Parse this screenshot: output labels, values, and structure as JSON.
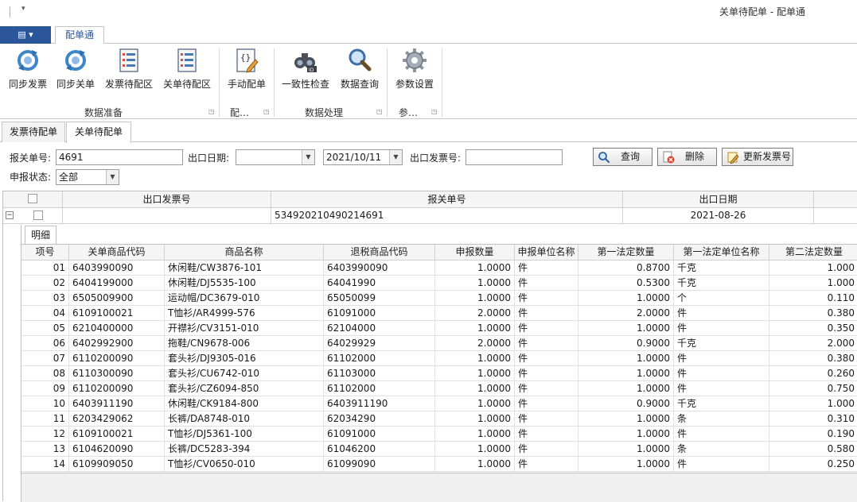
{
  "window": {
    "title": "关单待配单 - 配单通"
  },
  "app_menu": {
    "label": "▤ ▾"
  },
  "ribbon": {
    "tab": "配单通",
    "buttons": [
      {
        "label": "同步发票",
        "icon": "sync-icon"
      },
      {
        "label": "同步关单",
        "icon": "sync-icon"
      },
      {
        "label": "发票待配区",
        "icon": "list-icon"
      },
      {
        "label": "关单待配区",
        "icon": "list-icon"
      },
      {
        "label": "手动配单",
        "icon": "edit-code-icon"
      },
      {
        "label": "一致性检查",
        "icon": "binoculars-icon"
      },
      {
        "label": "数据查询",
        "icon": "magnifier-icon"
      },
      {
        "label": "参数设置",
        "icon": "gear-icon"
      }
    ],
    "groups": [
      "数据准备",
      "配…",
      "数据处理",
      "参…"
    ]
  },
  "doc_tabs": [
    "发票待配单",
    "关单待配单"
  ],
  "filter": {
    "customs_no_label": "报关单号:",
    "customs_no_value": "4691",
    "export_date_label": "出口日期:",
    "export_date_from": "",
    "export_date_to": "2021/10/11",
    "export_invoice_label": "出口发票号:",
    "export_invoice_value": "",
    "status_label": "申报状态:",
    "status_value": "全部",
    "query_button": "查询",
    "delete_button": "删除",
    "update_invoice_button": "更新发票号"
  },
  "master": {
    "columns": [
      "出口发票号",
      "报关单号",
      "出口日期"
    ],
    "row": {
      "invoice_no": "",
      "customs_no": "534920210490214691",
      "export_date": "2021-08-26"
    }
  },
  "detail": {
    "tab": "明细",
    "columns": [
      "项号",
      "关单商品代码",
      "商品名称",
      "退税商品代码",
      "申报数量",
      "申报单位名称",
      "第一法定数量",
      "第一法定单位名称",
      "第二法定数量"
    ],
    "rows": [
      [
        "01",
        "6403990090",
        "休闲鞋/CW3876-101",
        "6403990090",
        "1.0000",
        "件",
        "0.8700",
        "千克",
        "1.000"
      ],
      [
        "02",
        "6404199000",
        "休闲鞋/DJ5535-100",
        "64041990",
        "1.0000",
        "件",
        "0.5300",
        "千克",
        "1.000"
      ],
      [
        "03",
        "6505009900",
        "运动帽/DC3679-010",
        "65050099",
        "1.0000",
        "件",
        "1.0000",
        "个",
        "0.110"
      ],
      [
        "04",
        "6109100021",
        "T恤衫/AR4999-576",
        "61091000",
        "2.0000",
        "件",
        "2.0000",
        "件",
        "0.380"
      ],
      [
        "05",
        "6210400000",
        "开襟衫/CV3151-010",
        "62104000",
        "1.0000",
        "件",
        "1.0000",
        "件",
        "0.350"
      ],
      [
        "06",
        "6402992900",
        "拖鞋/CN9678-006",
        "64029929",
        "2.0000",
        "件",
        "0.9000",
        "千克",
        "2.000"
      ],
      [
        "07",
        "6110200090",
        "套头衫/DJ9305-016",
        "61102000",
        "1.0000",
        "件",
        "1.0000",
        "件",
        "0.380"
      ],
      [
        "08",
        "6110300090",
        "套头衫/CU6742-010",
        "61103000",
        "1.0000",
        "件",
        "1.0000",
        "件",
        "0.260"
      ],
      [
        "09",
        "6110200090",
        "套头衫/CZ6094-850",
        "61102000",
        "1.0000",
        "件",
        "1.0000",
        "件",
        "0.750"
      ],
      [
        "10",
        "6403911190",
        "休闲鞋/CK9184-800",
        "6403911190",
        "1.0000",
        "件",
        "0.9000",
        "千克",
        "1.000"
      ],
      [
        "11",
        "6203429062",
        "长裤/DA8748-010",
        "62034290",
        "1.0000",
        "件",
        "1.0000",
        "条",
        "0.310"
      ],
      [
        "12",
        "6109100021",
        "T恤衫/DJ5361-100",
        "61091000",
        "1.0000",
        "件",
        "1.0000",
        "件",
        "0.190"
      ],
      [
        "13",
        "6104620090",
        "长裤/DC5283-394",
        "61046200",
        "1.0000",
        "件",
        "1.0000",
        "条",
        "0.580"
      ],
      [
        "14",
        "6109909050",
        "T恤衫/CV0650-010",
        "61099090",
        "1.0000",
        "件",
        "1.0000",
        "件",
        "0.250"
      ]
    ]
  }
}
